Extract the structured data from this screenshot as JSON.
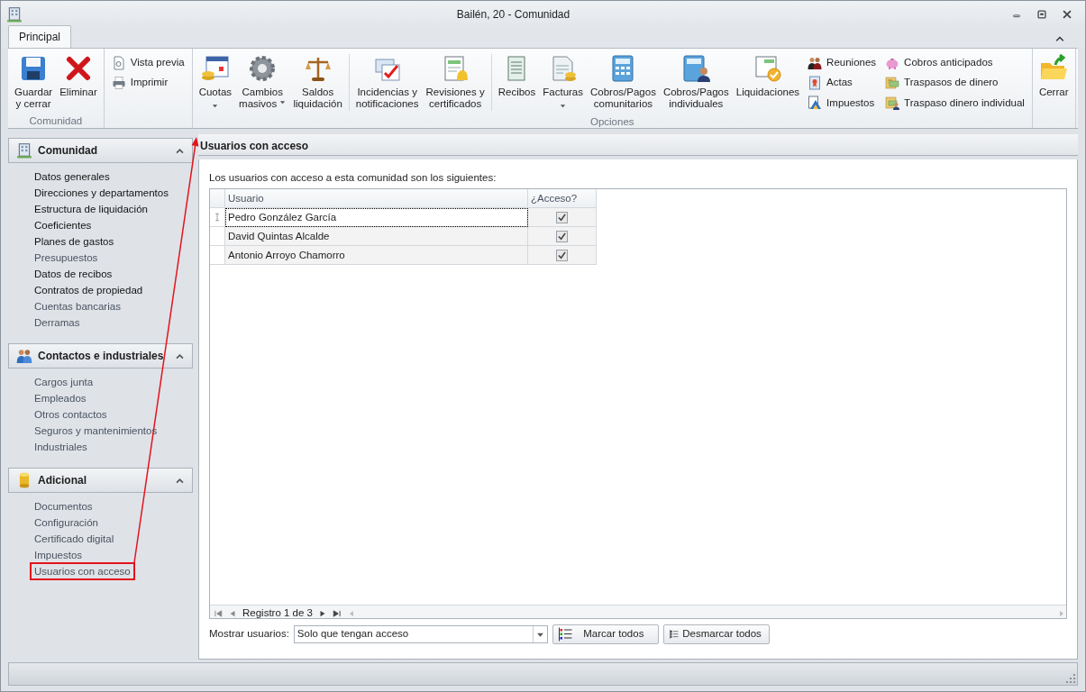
{
  "window": {
    "title": "Bailén, 20 - Comunidad"
  },
  "ribbon": {
    "tabs": [
      {
        "label": "Principal",
        "selected": true
      }
    ],
    "groups": [
      {
        "label": "Comunidad",
        "items": [
          {
            "kind": "large",
            "label": "Guardar\ny cerrar"
          },
          {
            "kind": "large",
            "label": "Eliminar"
          }
        ]
      },
      {
        "items": [
          {
            "kind": "stack",
            "entries": [
              "Vista previa",
              "Imprimir"
            ]
          }
        ]
      },
      {
        "label": "Opciones",
        "items": [
          {
            "kind": "large",
            "label": "Cuotas",
            "dropdown": true
          },
          {
            "kind": "large",
            "label": "Cambios\nmasivos",
            "dropdown": true
          },
          {
            "kind": "large",
            "label": "Saldos\nliquidación"
          },
          {
            "kind": "separator"
          },
          {
            "kind": "large",
            "label": "Incidencias y\nnotificaciones"
          },
          {
            "kind": "large",
            "label": "Revisiones y\ncertificados"
          },
          {
            "kind": "separator"
          },
          {
            "kind": "large",
            "label": "Recibos"
          },
          {
            "kind": "large",
            "label": "Facturas",
            "dropdown": true
          },
          {
            "kind": "large",
            "label": "Cobros/Pagos\ncomunitarios"
          },
          {
            "kind": "large",
            "label": "Cobros/Pagos\nindividuales"
          },
          {
            "kind": "large",
            "label": "Liquidaciones"
          },
          {
            "kind": "stack",
            "entries": [
              "Reuniones",
              "Actas",
              "Impuestos"
            ]
          },
          {
            "kind": "stack",
            "entries": [
              "Cobros anticipados",
              "Traspasos de dinero",
              "Traspaso dinero individual"
            ]
          }
        ]
      },
      {
        "items": [
          {
            "kind": "large",
            "label": "Cerrar"
          }
        ]
      }
    ]
  },
  "sidebar": {
    "sections": [
      {
        "title": "Comunidad",
        "expanded": true,
        "items": [
          {
            "label": "Datos generales",
            "dimmed": false
          },
          {
            "label": "Direcciones y departamentos",
            "dimmed": false
          },
          {
            "label": "Estructura de liquidación",
            "dimmed": false
          },
          {
            "label": "Coeficientes",
            "dimmed": false
          },
          {
            "label": "Planes de gastos",
            "dimmed": false
          },
          {
            "label": "Presupuestos",
            "dimmed": true
          },
          {
            "label": "Datos de recibos",
            "dimmed": false
          },
          {
            "label": "Contratos de propiedad",
            "dimmed": false
          },
          {
            "label": "Cuentas bancarias",
            "dimmed": true
          },
          {
            "label": "Derramas",
            "dimmed": true
          }
        ]
      },
      {
        "title": "Contactos e industriales",
        "expanded": true,
        "items": [
          {
            "label": "Cargos junta",
            "dimmed": true
          },
          {
            "label": "Empleados",
            "dimmed": true
          },
          {
            "label": "Otros contactos",
            "dimmed": true
          },
          {
            "label": "Seguros y mantenimientos",
            "dimmed": true
          },
          {
            "label": "Industriales",
            "dimmed": true
          }
        ]
      },
      {
        "title": "Adicional",
        "expanded": true,
        "items": [
          {
            "label": "Documentos",
            "dimmed": true
          },
          {
            "label": "Configuración",
            "dimmed": true
          },
          {
            "label": "Certificado digital",
            "dimmed": true
          },
          {
            "label": "Impuestos",
            "dimmed": true
          },
          {
            "label": "Usuarios con acceso",
            "dimmed": true,
            "highlighted": true
          }
        ]
      }
    ]
  },
  "panel": {
    "title": "Usuarios con acceso",
    "intro": "Los usuarios con acceso a esta comunidad son los siguientes:",
    "table": {
      "columns": [
        "Usuario",
        "¿Acceso?"
      ],
      "rows": [
        {
          "user": "Pedro González García",
          "access": true,
          "selected": true
        },
        {
          "user": "David Quintas Alcalde",
          "access": true,
          "selected": false
        },
        {
          "user": "Antonio Arroyo Chamorro",
          "access": true,
          "selected": false
        }
      ]
    },
    "navigator": "Registro 1 de 3",
    "filter": {
      "label": "Mostrar usuarios:",
      "value": "Solo que tengan acceso"
    },
    "buttons": [
      "Marcar todos",
      "Desmarcar todos"
    ]
  }
}
